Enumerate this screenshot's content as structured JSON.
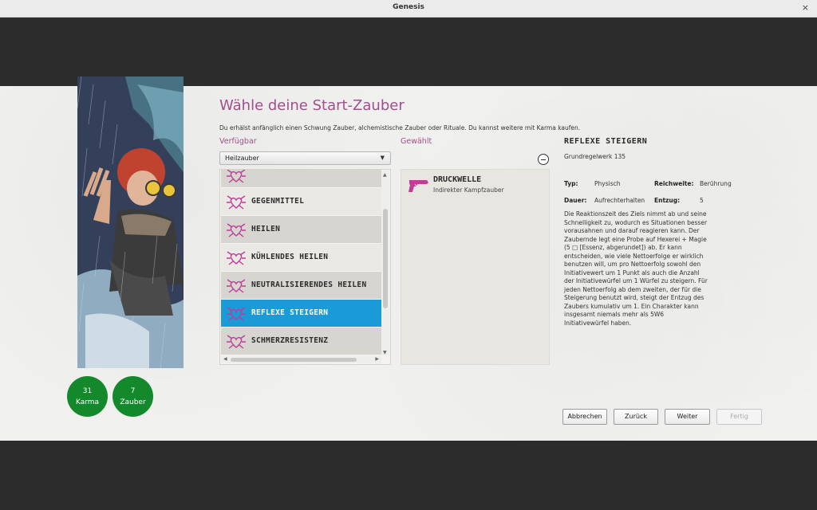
{
  "window": {
    "title": "Genesis",
    "close_glyph": "×"
  },
  "heading": "Wähle deine Start-Zauber",
  "intro": "Du erhälst anfänglich einen Schwung Zauber, alchemistische Zauber oder Rituale. Du kannst weitere mit Karma kaufen.",
  "available": {
    "label": "Verfügbar",
    "category": "Heilzauber",
    "items": [
      {
        "name": "",
        "icon": "heart-spell-icon"
      },
      {
        "name": "GEGENMITTEL",
        "icon": "heart-spell-icon"
      },
      {
        "name": "HEILEN",
        "icon": "heart-spell-icon"
      },
      {
        "name": "KÜHLENDES HEILEN",
        "icon": "heart-spell-icon"
      },
      {
        "name": "NEUTRALISIERENDES HEILEN",
        "icon": "heart-spell-icon"
      },
      {
        "name": "REFLEXE STEIGERN",
        "icon": "heart-spell-icon",
        "selected": true
      },
      {
        "name": "SCHMERZRESISTENZ",
        "icon": "heart-spell-icon"
      }
    ]
  },
  "chosen": {
    "label": "Gewählt",
    "items": [
      {
        "name": "DRUCKWELLE",
        "subtitle": "Indirekter Kampfzauber",
        "icon": "pistol-icon"
      }
    ]
  },
  "detail": {
    "title": "REFLEXE STEIGERN",
    "source": "Grundregelwerk 135",
    "type_label": "Typ:",
    "type_value": "Physisch",
    "range_label": "Reichweite:",
    "range_value": "Berührung",
    "duration_label": "Dauer:",
    "duration_value": "Aufrechterhalten",
    "drain_label": "Entzug:",
    "drain_value": "5",
    "description": "Die Reaktionszeit des Ziels nimmt ab und seine Schnelligkeit zu, wodurch es Situationen besser vorausahnen und darauf reagieren kann. Der Zaubernde legt eine Probe auf Hexerei + Magie (5 □ [Essenz, abgerundet]) ab. Er kann entscheiden, wie viele Nettoerfolge er wirklich benutzen will, um pro Nettoerfolg sowohl den Initiativewert um 1 Punkt als auch die Anzahl der Initiativewürfel um 1 Würfel zu steigern. Für jeden Nettoerfolg ab dem zweiten, der für die Steigerung benutzt wird, steigt der Entzug des Zaubers kumulativ um 1. Ein Charakter kann insgesamt niemals mehr als 5W6 Initiativewürfel haben."
  },
  "badges": {
    "karma": {
      "value": "31",
      "label": "Karma"
    },
    "spells": {
      "value": "7",
      "label": "Zauber"
    }
  },
  "buttons": {
    "cancel": "Abbrechen",
    "back": "Zurück",
    "next": "Weiter",
    "finish": "Fertig"
  },
  "colors": {
    "accent": "#a0508c",
    "selection": "#1a9ad6",
    "badge": "#14892c",
    "icon": "#c03d9a"
  }
}
